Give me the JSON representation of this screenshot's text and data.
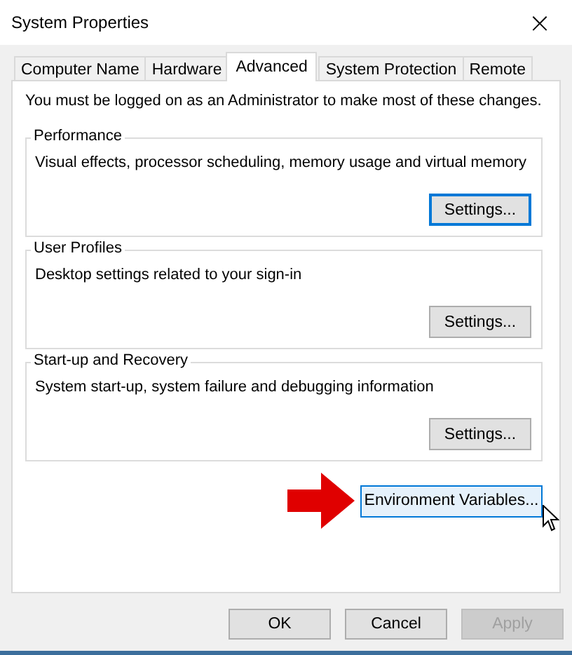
{
  "window": {
    "title": "System Properties",
    "close": "×"
  },
  "tabs": [
    {
      "label": "Computer Name",
      "selected": false
    },
    {
      "label": "Hardware",
      "selected": false
    },
    {
      "label": "Advanced",
      "selected": true
    },
    {
      "label": "System Protection",
      "selected": false
    },
    {
      "label": "Remote",
      "selected": false
    }
  ],
  "notice": "You must be logged on as an Administrator to make most of these changes.",
  "groups": [
    {
      "title": "Performance",
      "description": "Visual effects, processor scheduling, memory usage and virtual memory",
      "button": {
        "label": "Settings...",
        "focused": true,
        "hovered": false
      }
    },
    {
      "title": "User Profiles",
      "description": "Desktop settings related to your sign-in",
      "button": {
        "label": "Settings...",
        "focused": false,
        "hovered": false
      }
    },
    {
      "title": "Start-up and Recovery",
      "description": "System start-up, system failure and debugging information",
      "button": {
        "label": "Settings...",
        "focused": false,
        "hovered": false
      }
    }
  ],
  "environment_button": {
    "label": "Environment Variables...",
    "focused": false,
    "hovered": true
  },
  "buttons": [
    {
      "label": "OK",
      "disabled": false
    },
    {
      "label": "Cancel",
      "disabled": false
    },
    {
      "label": "Apply",
      "disabled": true
    }
  ]
}
